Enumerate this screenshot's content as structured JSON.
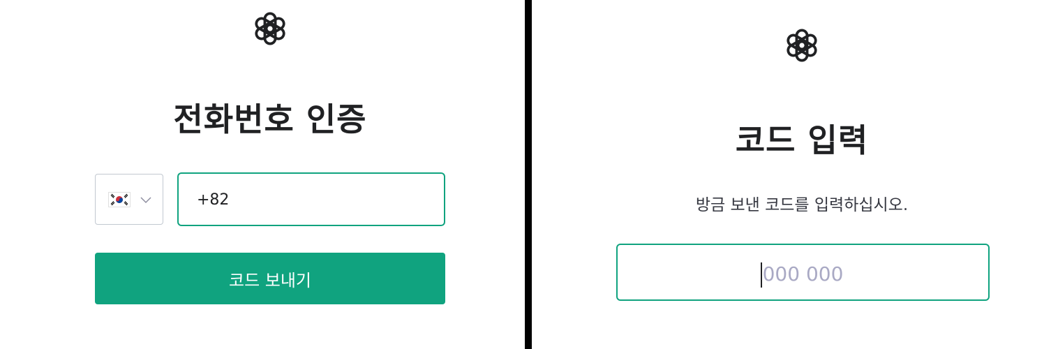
{
  "phone_screen": {
    "logo_icon": "openai-logo-icon",
    "title": "전화번호 인증",
    "country": {
      "flag_icon": "south-korea-flag-icon",
      "dropdown_icon": "chevron-down-icon"
    },
    "phone_input": {
      "value": "+82"
    },
    "send_button_label": "코드 보내기"
  },
  "code_screen": {
    "logo_icon": "openai-logo-icon",
    "title": "코드 입력",
    "subtitle": "방금 보낸 코드를 입력하십시오.",
    "code_input": {
      "value": "",
      "placeholder": "000 000"
    }
  },
  "colors": {
    "accent": "#10a37f",
    "text": "#202123",
    "placeholder": "#a9a9c4",
    "divider": "#000000"
  }
}
